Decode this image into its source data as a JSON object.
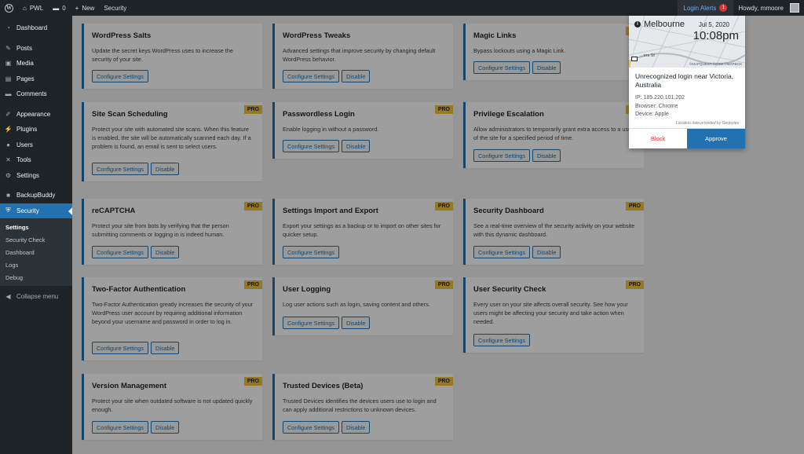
{
  "adminbar": {
    "site_name": "PWL",
    "comments_count": "0",
    "new_label": "New",
    "security_label": "Security",
    "login_alerts_label": "Login Alerts",
    "login_alerts_count": "1",
    "howdy": "Howdy, mmoore"
  },
  "sidebar": {
    "items": [
      {
        "label": "Dashboard",
        "icon": "dashboard-icon"
      },
      {
        "label": "Posts",
        "icon": "pin-icon"
      },
      {
        "label": "Media",
        "icon": "media-icon"
      },
      {
        "label": "Pages",
        "icon": "page-icon"
      },
      {
        "label": "Comments",
        "icon": "comment-icon"
      },
      {
        "label": "Appearance",
        "icon": "brush-icon"
      },
      {
        "label": "Plugins",
        "icon": "plug-icon"
      },
      {
        "label": "Users",
        "icon": "user-icon"
      },
      {
        "label": "Tools",
        "icon": "wrench-icon"
      },
      {
        "label": "Settings",
        "icon": "settings-icon"
      },
      {
        "label": "BackupBuddy",
        "icon": "backup-icon"
      },
      {
        "label": "Security",
        "icon": "shield-icon"
      }
    ],
    "submenu": [
      "Settings",
      "Security Check",
      "Dashboard",
      "Logs",
      "Debug"
    ],
    "collapse_label": "Collapse menu"
  },
  "cards": [
    {
      "title": "WordPress Salts",
      "desc": "Update the secret keys WordPress uses to increase the security of your site.",
      "pro": false,
      "buttons": [
        "Configure Settings"
      ]
    },
    {
      "title": "WordPress Tweaks",
      "desc": "Advanced settings that improve security by changing default WordPress behavior.",
      "pro": false,
      "buttons": [
        "Configure Settings",
        "Disable"
      ]
    },
    {
      "title": "Magic Links",
      "desc": "Bypass lockouts using a Magic Link.",
      "pro": true,
      "buttons": [
        "Configure Settings",
        "Disable"
      ]
    },
    {
      "title": "Site Scan Scheduling",
      "desc": "Protect your site with automated site scans. When this feature is enabled, the site will be automatically scanned each day. If a problem is found, an email is sent to select users.",
      "pro": true,
      "buttons": [
        "Configure Settings",
        "Disable"
      ]
    },
    {
      "title": "Passwordless Login",
      "desc": "Enable logging in without a password.",
      "pro": true,
      "buttons": [
        "Configure Settings",
        "Disable"
      ]
    },
    {
      "title": "Privilege Escalation",
      "desc": "Allow administrators to temporarily grant extra access to a user of the site for a specified period of time.",
      "pro": true,
      "buttons": [
        "Configure Settings",
        "Disable"
      ]
    },
    {
      "title": "reCAPTCHA",
      "desc": "Protect your site from bots by verifying that the person submitting comments or logging in is indeed human.",
      "pro": true,
      "buttons": [
        "Configure Settings",
        "Disable"
      ]
    },
    {
      "title": "Settings Import and Export",
      "desc": "Export your settings as a backup or to import on other sites for quicker setup.",
      "pro": true,
      "buttons": [
        "Configure Settings"
      ]
    },
    {
      "title": "Security Dashboard",
      "desc": "See a real-time overview of the security activity on your website with this dynamic dashboard.",
      "pro": true,
      "buttons": [
        "Configure Settings",
        "Disable"
      ]
    },
    {
      "title": "Two-Factor Authentication",
      "desc": "Two-Factor Authentication greatly increases the security of your WordPress user account by requiring additional information beyond your username and password in order to log in.",
      "pro": true,
      "buttons": [
        "Configure Settings",
        "Disable"
      ]
    },
    {
      "title": "User Logging",
      "desc": "Log user actions such as login, saving content and others.",
      "pro": true,
      "buttons": [
        "Configure Settings",
        "Disable"
      ]
    },
    {
      "title": "User Security Check",
      "desc": "Every user on your site affects overall security. See how your users might be affecting your security and take action when needed.",
      "pro": true,
      "buttons": [
        "Configure Settings"
      ]
    },
    {
      "title": "Version Management",
      "desc": "Protect your site when outdated software is not updated quickly enough.",
      "pro": true,
      "buttons": [
        "Configure Settings",
        "Disable"
      ]
    },
    {
      "title": "Trusted Devices (Beta)",
      "desc": "Trusted Devices identifies the devices users use to login and can apply additional restrictions to unknown devices.",
      "pro": true,
      "buttons": [
        "Configure Settings",
        "Disable"
      ]
    }
  ],
  "pro_label": "PRO",
  "popup": {
    "city": "Melbourne",
    "date": "Jul 5, 2020",
    "time": "10:08pm",
    "street": "...ers St",
    "map_attribution": "©MAPQUEST ©OSM ©MAPBOX",
    "title": "Unrecognized login near Victoria, Australia",
    "ip": "IP: 185.220.101.202",
    "browser_prefix": "Browser: ",
    "browser": "Chrome",
    "device_prefix": "Device: ",
    "device": "Apple",
    "note": "Location data provided by Geobytes",
    "block_label": "Block",
    "approve_label": "Approve"
  }
}
